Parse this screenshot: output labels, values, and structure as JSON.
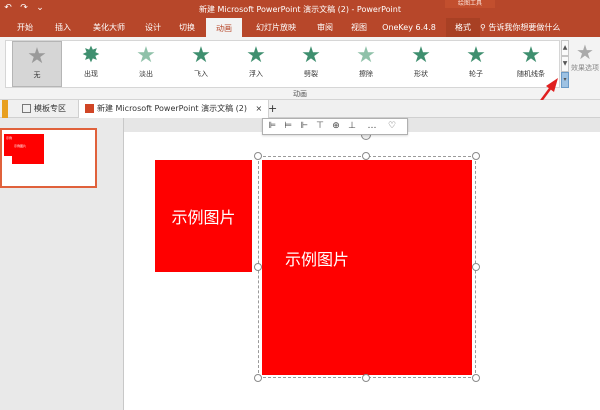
{
  "titlebar": {
    "title": "新建 Microsoft PowerPoint 演示文稿 (2)  -  PowerPoint",
    "context_title": "绘图工具",
    "quick_access": {
      "undo": "↶",
      "redo": "↷",
      "custom": "⌄"
    }
  },
  "tabs": [
    {
      "label": "开始",
      "active": false
    },
    {
      "label": "插入",
      "active": false
    },
    {
      "label": "美化大师",
      "active": false
    },
    {
      "label": "设计",
      "active": false
    },
    {
      "label": "切换",
      "active": false
    },
    {
      "label": "动画",
      "active": true
    },
    {
      "label": "幻灯片放映",
      "active": false
    },
    {
      "label": "审阅",
      "active": false
    },
    {
      "label": "视图",
      "active": false
    },
    {
      "label": "OneKey 6.4.8",
      "active": false
    },
    {
      "label": "格式",
      "active": false
    }
  ],
  "tell_me": "告诉我你想要做什么",
  "ribbon": {
    "group_label": "动画",
    "animations": [
      {
        "label": "无",
        "icon": "star-icon",
        "selected": true
      },
      {
        "label": "出现",
        "icon": "star-burst-icon",
        "selected": false
      },
      {
        "label": "淡出",
        "icon": "star-icon",
        "selected": false
      },
      {
        "label": "飞入",
        "icon": "star-icon",
        "selected": false
      },
      {
        "label": "浮入",
        "icon": "star-icon",
        "selected": false
      },
      {
        "label": "劈裂",
        "icon": "star-icon",
        "selected": false
      },
      {
        "label": "擦除",
        "icon": "star-icon",
        "selected": false
      },
      {
        "label": "形状",
        "icon": "star-icon",
        "selected": false
      },
      {
        "label": "轮子",
        "icon": "star-icon",
        "selected": false
      },
      {
        "label": "随机线条",
        "icon": "star-icon",
        "selected": false
      }
    ],
    "effect_options": "效果选项"
  },
  "doc_tabs": [
    {
      "label": "模板专区",
      "active": false
    },
    {
      "label": "新建 Microsoft PowerPoint 演示文稿 (2)",
      "active": true
    }
  ],
  "doc_tabs_close": "×",
  "doc_tabs_add": "+",
  "slide": {
    "image1_text": "示例图片",
    "image2_text": "示例图片",
    "thumb_text1": "示例图片",
    "thumb_text2": "示例图片"
  },
  "colors": {
    "accent": "#b7472a",
    "image_fill": "#ff0000"
  }
}
